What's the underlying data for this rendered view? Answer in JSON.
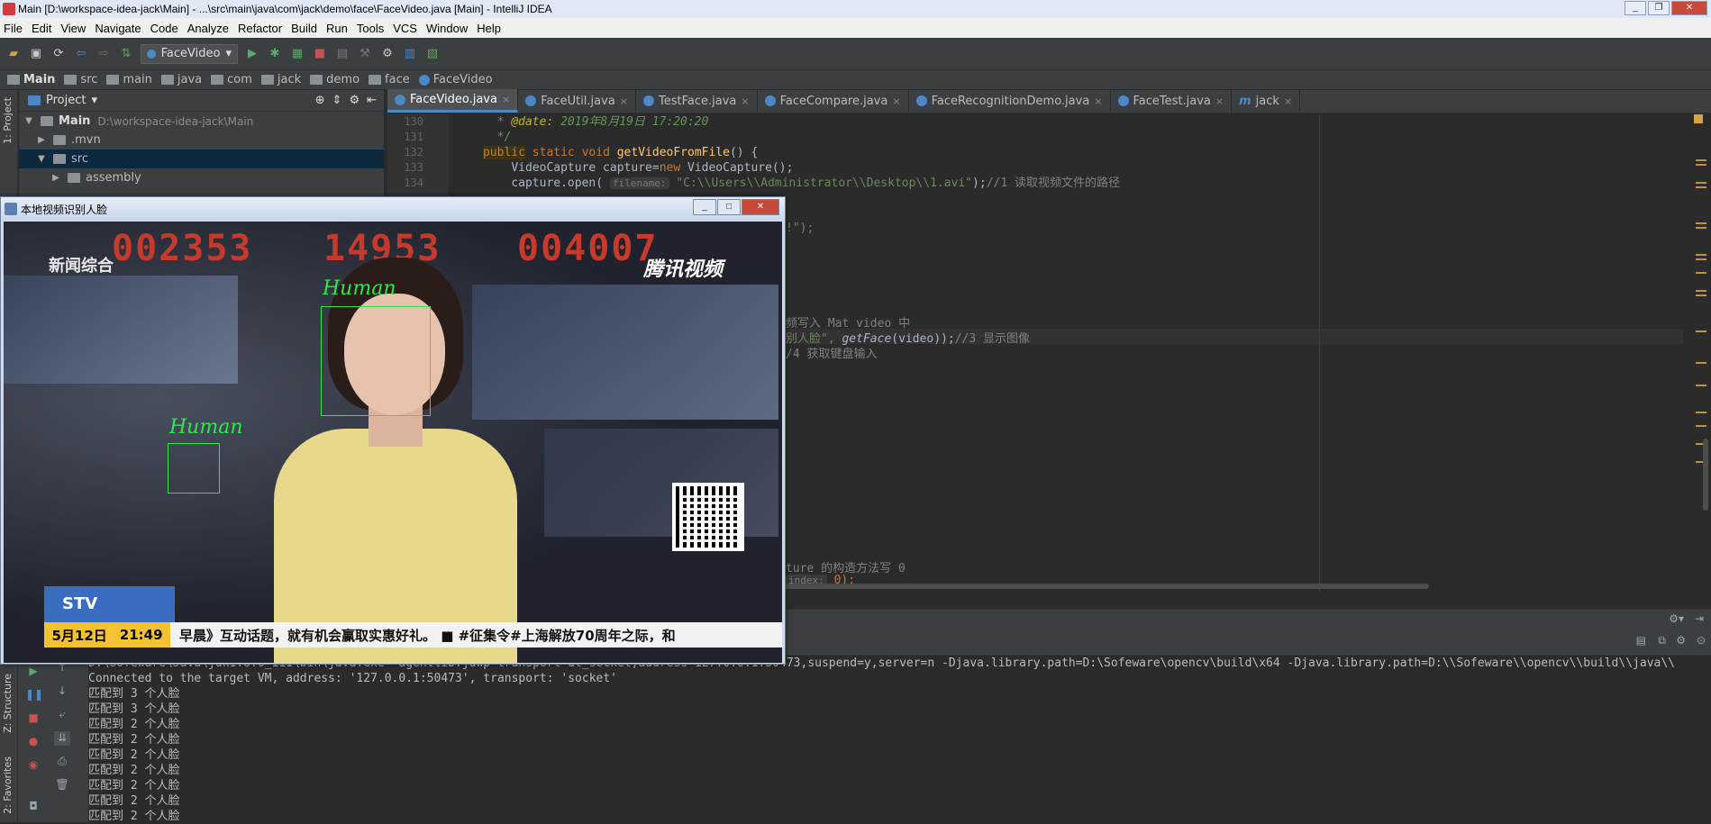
{
  "window": {
    "title": "Main [D:\\workspace-idea-jack\\Main] - ...\\src\\main\\java\\com\\jack\\demo\\face\\FaceVideo.java [Main] - IntelliJ IDEA"
  },
  "menu": [
    "File",
    "Edit",
    "View",
    "Navigate",
    "Code",
    "Analyze",
    "Refactor",
    "Build",
    "Run",
    "Tools",
    "VCS",
    "Window",
    "Help"
  ],
  "toolbar": {
    "run_config": "FaceVideo"
  },
  "breadcrumb": [
    "Main",
    "src",
    "main",
    "java",
    "com",
    "jack",
    "demo",
    "face",
    "FaceVideo"
  ],
  "left_stripe": {
    "project": "1: Project",
    "structure": "Z: Structure",
    "favorites": "2: Favorites"
  },
  "project": {
    "header": "Project",
    "items": [
      {
        "name": "Main",
        "path": "D:\\workspace-idea-jack\\Main"
      },
      {
        "name": ".mvn"
      },
      {
        "name": "src"
      },
      {
        "name": "assembly"
      }
    ]
  },
  "tabs": [
    "FaceVideo.java",
    "FaceUtil.java",
    "TestFace.java",
    "FaceCompare.java",
    "FaceRecognitionDemo.java",
    "FaceTest.java",
    "jack"
  ],
  "editor": {
    "line_numbers": [
      "130",
      "131",
      "132",
      "133",
      "134"
    ],
    "lines": {
      "l130_tag": "@date:",
      "l130_text": " 2019年8月19日 17:20:20",
      "l131": "*/",
      "l132_kw1": "public",
      "l132_kw2": "static",
      "l132_kw3": "void",
      "l132_fn": "getVideoFromFile",
      "l132_rest": "() {",
      "l133": "VideoCapture capture=",
      "l133_kw": "new",
      "l133_rest": " VideoCapture();",
      "l134_a": "capture.open( ",
      "l134_hint": "filename:",
      "l134_str": " \"C:\\\\Users\\\\Administrator\\\\Desktop\\\\1.avi\"",
      "l134_b": ");",
      "l134_cm": "//1 读取视频文件的路径"
    },
    "partial": {
      "p1": "!\");",
      "p2": "频写入 Mat video 中",
      "p3a": "别人脸\",",
      "p3b": " getFace",
      "p3c": "(video));",
      "p3d": "//3 显示图像",
      "p4": "/4 获取键盘输入",
      "p5": "ture 的构造方法写 0",
      "p6a": "index:",
      "p6b": " 0);"
    }
  },
  "float_window": {
    "title": "本地视频识别人脸",
    "ticker": [
      "002353",
      "14953",
      "004007"
    ],
    "logo_left": "新闻综合",
    "logo_right": "腾讯视频",
    "face_label": "Human",
    "channel": "STV",
    "date": "5月12日",
    "time": "21:49",
    "news": "早晨》互动话题，就有机会赢取实惠好礼。   ■ #征集令#上海解放70周年之际，和"
  },
  "console": {
    "lines": [
      "D:\\Sofeware\\Java\\jdk1.8.0_111\\bin\\java.exe -agentlib:jdwp=transport=dt_socket,address=127.0.0.1:50473,suspend=y,server=n -Djava.library.path=D:\\Sofeware\\opencv\\build\\x64 -Djava.library.path=D:\\\\Sofeware\\\\opencv\\\\build\\\\java\\\\",
      "Connected to the target VM, address: '127.0.0.1:50473', transport: 'socket'",
      "匹配到 3 个人脸",
      "匹配到 3 个人脸",
      "匹配到 2 个人脸",
      "匹配到 2 个人脸",
      "匹配到 2 个人脸",
      "匹配到 2 个人脸",
      "匹配到 2 个人脸",
      "匹配到 2 个人脸",
      "匹配到 2 个人脸"
    ]
  },
  "colors": {
    "accent": "#4a88c7",
    "face_box": "#2ee84a"
  }
}
